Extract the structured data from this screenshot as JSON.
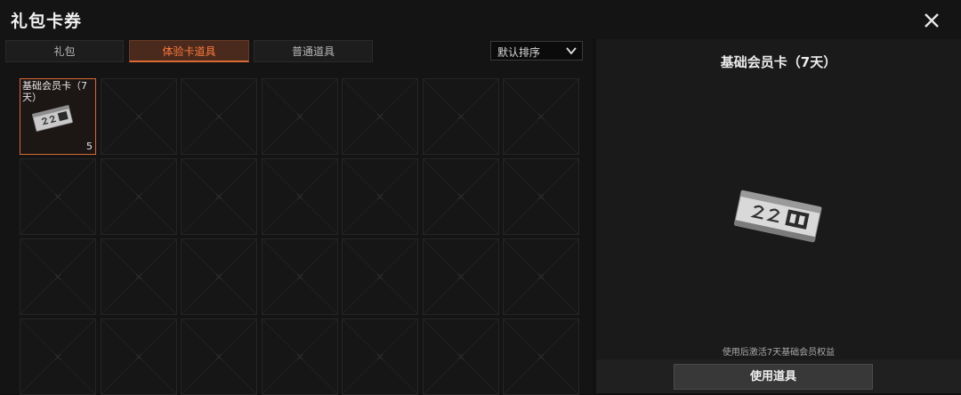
{
  "window": {
    "title": "礼包卡券"
  },
  "tabs": [
    {
      "label": "礼包",
      "active": false
    },
    {
      "label": "体验卡道具",
      "active": true
    },
    {
      "label": "普通道具",
      "active": false
    }
  ],
  "sort": {
    "label": "默认排序"
  },
  "inventory": {
    "columns": 7,
    "visible_rows": 4,
    "items": [
      {
        "name": "基础会员卡（7天）",
        "count": "5",
        "selected": true
      }
    ]
  },
  "detail": {
    "title": "基础会员卡（7天）",
    "description": "使用后激活7天基础会员权益",
    "use_button": "使用道具"
  },
  "colors": {
    "accent": "#d96a34",
    "tab_active_text": "#ff7a3c",
    "background": "#111111"
  },
  "icons": {
    "close": "close-icon",
    "dropdown": "chevron-down-icon",
    "card": "membership-card-icon"
  }
}
